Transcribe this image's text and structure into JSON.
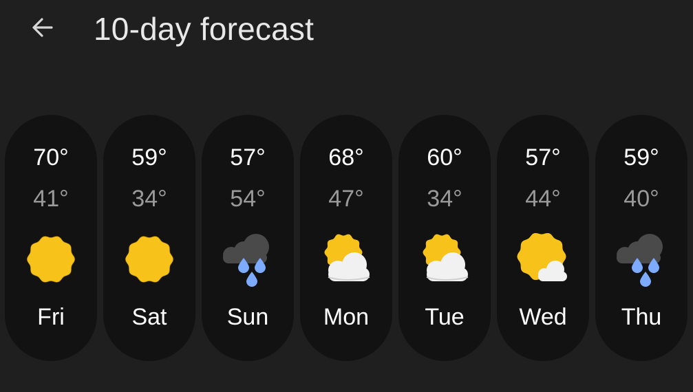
{
  "header": {
    "back_icon": "arrow-back-icon",
    "title": "10-day forecast"
  },
  "days": [
    {
      "day": "Fri",
      "high": "70°",
      "low": "41°",
      "icon": "sunny-icon"
    },
    {
      "day": "Sat",
      "high": "59°",
      "low": "34°",
      "icon": "sunny-icon"
    },
    {
      "day": "Sun",
      "high": "57°",
      "low": "54°",
      "icon": "rain-cloud-icon"
    },
    {
      "day": "Mon",
      "high": "68°",
      "low": "47°",
      "icon": "partly-cloudy-icon"
    },
    {
      "day": "Tue",
      "high": "60°",
      "low": "34°",
      "icon": "partly-cloudy-icon"
    },
    {
      "day": "Wed",
      "high": "57°",
      "low": "44°",
      "icon": "mostly-sunny-icon"
    },
    {
      "day": "Thu",
      "high": "59°",
      "low": "40°",
      "icon": "rain-cloud-icon"
    }
  ],
  "colors": {
    "background": "#1f1f1f",
    "card": "#121212",
    "low_temp": "#9a9a9a",
    "sun": "#f7c31a",
    "rain": "#7cabff"
  }
}
